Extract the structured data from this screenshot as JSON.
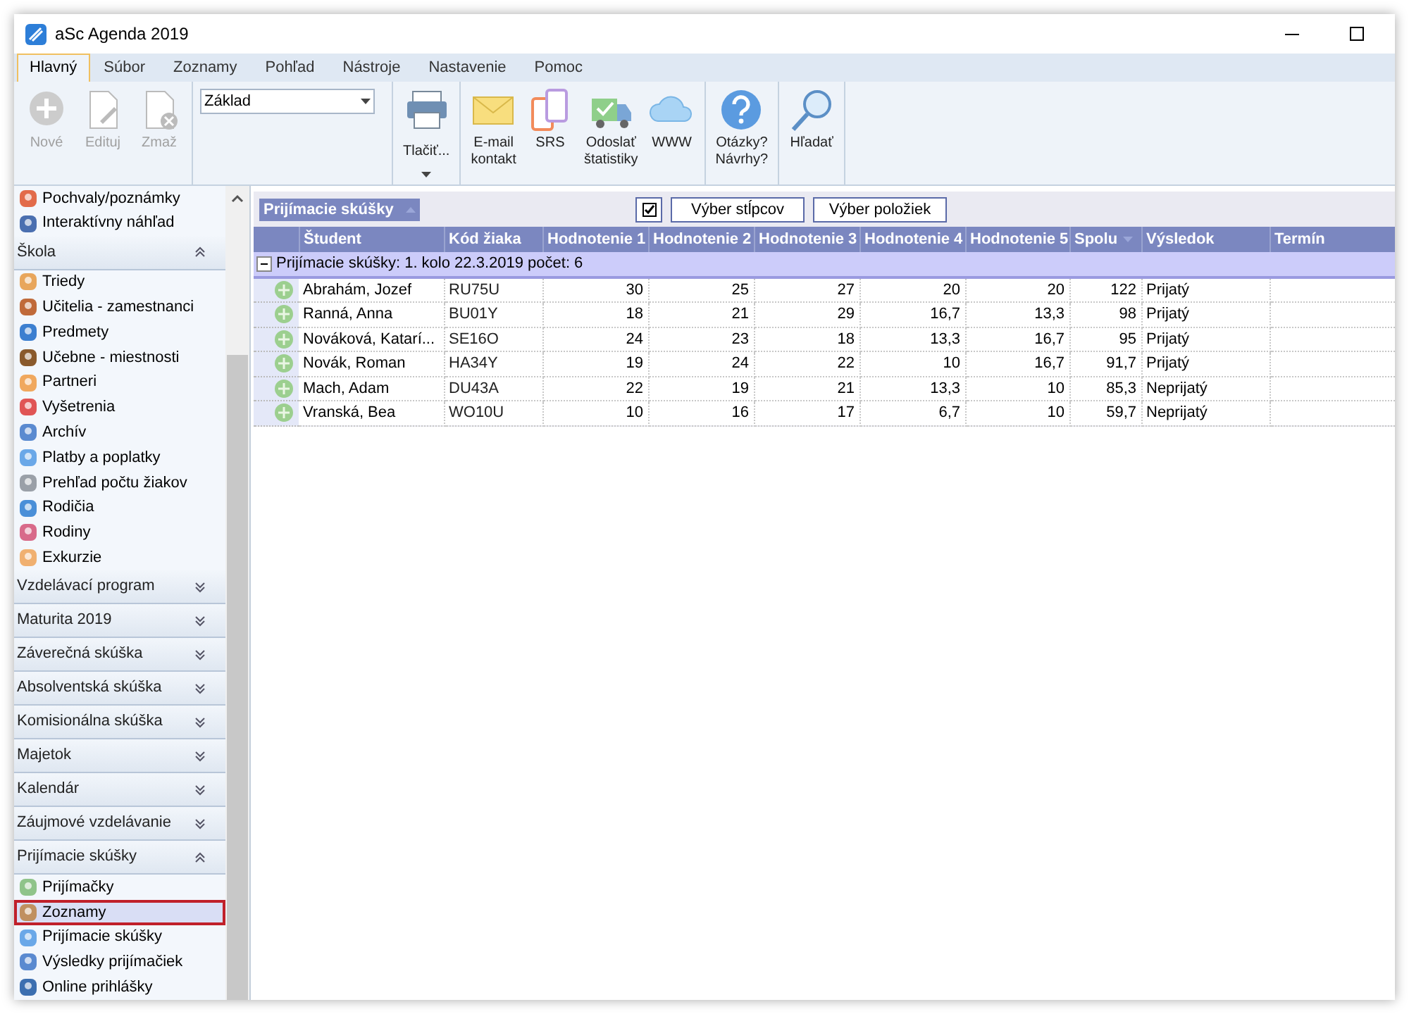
{
  "window": {
    "title": "aSc Agenda 2019"
  },
  "ribbon_tabs": [
    {
      "label": "Hlavný",
      "selected": true
    },
    {
      "label": "Súbor",
      "selected": false
    },
    {
      "label": "Zoznamy",
      "selected": false
    },
    {
      "label": "Pohľad",
      "selected": false
    },
    {
      "label": "Nástroje",
      "selected": false
    },
    {
      "label": "Nastavenie",
      "selected": false
    },
    {
      "label": "Pomoc",
      "selected": false
    }
  ],
  "ribbon_groups": [
    {
      "items": [
        {
          "kind": "button",
          "label": "Nové",
          "disabled": true
        },
        {
          "kind": "button",
          "label": "Edituj",
          "disabled": true
        },
        {
          "kind": "button",
          "label": "Zmaž",
          "disabled": true
        }
      ]
    },
    {
      "items": [
        {
          "kind": "dropdown",
          "value": "Základ"
        }
      ]
    },
    {
      "items": [
        {
          "kind": "split",
          "label": "Tlačiť...",
          "disabled": false
        }
      ]
    },
    {
      "items": [
        {
          "kind": "button",
          "label": "E-mail\nkontakt",
          "disabled": false
        },
        {
          "kind": "button",
          "label": "SRS",
          "disabled": false
        },
        {
          "kind": "button",
          "label": "Odoslať\nštatistiky",
          "disabled": false
        },
        {
          "kind": "button",
          "label": "WWW",
          "disabled": false
        }
      ]
    },
    {
      "items": [
        {
          "kind": "button",
          "label": "Otázky?\nNávrhy?",
          "disabled": false
        }
      ]
    },
    {
      "items": [
        {
          "kind": "button",
          "label": "Hľadať",
          "disabled": false
        }
      ]
    }
  ],
  "sidebar": {
    "top_items": [
      {
        "label": "Pochvaly/poznámky",
        "selected": false
      },
      {
        "label": "Interaktívny náhľad",
        "selected": false
      }
    ],
    "sections": [
      {
        "title": "Škola",
        "expanded": true,
        "items": [
          {
            "label": "Triedy",
            "selected": false
          },
          {
            "label": "Učitelia - zamestnanci",
            "selected": false
          },
          {
            "label": "Predmety",
            "selected": false
          },
          {
            "label": "Učebne - miestnosti",
            "selected": false
          },
          {
            "label": "Partneri",
            "selected": false
          },
          {
            "label": "Vyšetrenia",
            "selected": false
          },
          {
            "label": "Archív",
            "selected": false
          },
          {
            "label": "Platby a poplatky",
            "selected": false
          },
          {
            "label": "Prehľad počtu žiakov",
            "selected": false
          },
          {
            "label": "Rodičia",
            "selected": false
          },
          {
            "label": "Rodiny",
            "selected": false
          },
          {
            "label": "Exkurzie",
            "selected": false
          }
        ]
      },
      {
        "title": "Vzdelávací program",
        "expanded": false
      },
      {
        "title": "Maturita 2019",
        "expanded": false
      },
      {
        "title": "Záverečná skúška",
        "expanded": false
      },
      {
        "title": "Absolventská skúška",
        "expanded": false
      },
      {
        "title": "Komisionálna skúška",
        "expanded": false
      },
      {
        "title": "Majetok",
        "expanded": false
      },
      {
        "title": "Kalendár",
        "expanded": false
      },
      {
        "title": "Záujmové vzdelávanie",
        "expanded": false
      },
      {
        "title": "Prijímacie skúšky",
        "expanded": true,
        "items": [
          {
            "label": "Prijímačky",
            "selected": false
          },
          {
            "label": "Zoznamy",
            "selected": true
          },
          {
            "label": "Prijímacie skúšky",
            "selected": false
          },
          {
            "label": "Výsledky prijímačiek",
            "selected": false
          },
          {
            "label": "Online prihlášky",
            "selected": false
          }
        ]
      }
    ]
  },
  "grid": {
    "group_by": "Prijímacie skúšky",
    "buttons": [
      "Výber stĺpcov",
      "Výber položiek"
    ],
    "columns": [
      "Študent",
      "Kód žiaka",
      "Hodnotenie 1",
      "Hodnotenie 2",
      "Hodnotenie 3",
      "Hodnotenie 4",
      "Hodnotenie 5",
      "Spolu",
      "Výsledok",
      "Termín"
    ],
    "group_row": {
      "label": "Prijímacie skúšky: 1. kolo 22.3.2019 počet: 6",
      "expanded": true
    },
    "rows": [
      [
        "Abrahám, Jozef",
        "RU75U",
        "30",
        "25",
        "27",
        "20",
        "20",
        "122",
        "Prijatý"
      ],
      [
        "Ranná, Anna",
        "BU01Y",
        "18",
        "21",
        "29",
        "16,7",
        "13,3",
        "98",
        "Prijatý"
      ],
      [
        "Nováková, Katarí...",
        "SE16O",
        "24",
        "23",
        "18",
        "13,3",
        "16,7",
        "95",
        "Prijatý"
      ],
      [
        "Novák, Roman",
        "HA34Y",
        "19",
        "24",
        "22",
        "10",
        "16,7",
        "91,7",
        "Prijatý"
      ],
      [
        "Mach, Adam",
        "DU43A",
        "22",
        "19",
        "21",
        "13,3",
        "10",
        "85,3",
        "Neprijatý"
      ],
      [
        "Vranská, Bea",
        "WO10U",
        "10",
        "16",
        "17",
        "6,7",
        "10",
        "59,7",
        "Neprijatý"
      ]
    ]
  }
}
